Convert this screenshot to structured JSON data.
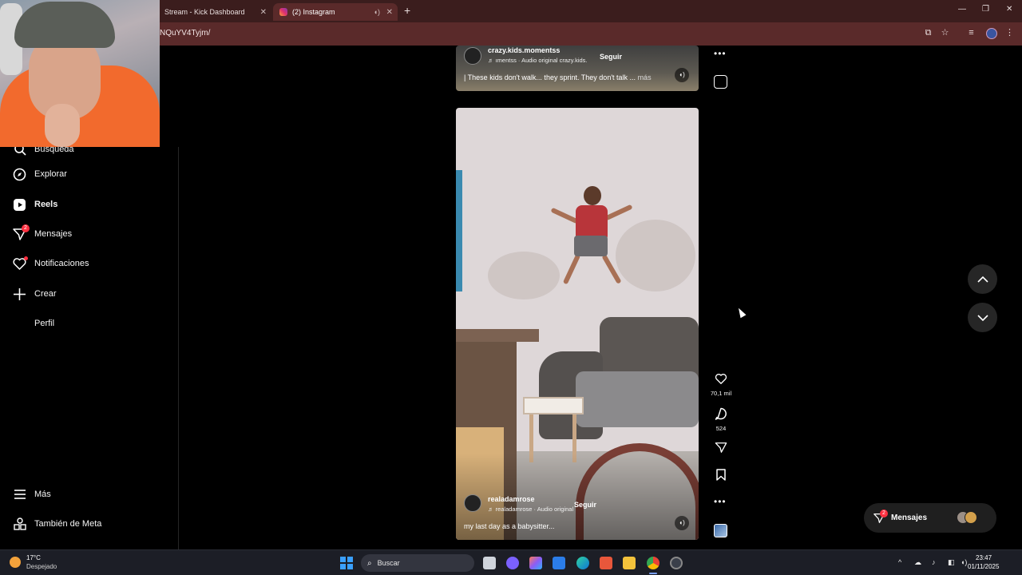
{
  "browser": {
    "tabs": [
      {
        "title": "Stream - Kick Dashboard"
      },
      {
        "title": "(2) Instagram"
      }
    ],
    "url": "NQuYV4Tyjm/"
  },
  "sidebar": {
    "items": [
      {
        "label": "Búsqueda",
        "icon": "search-icon"
      },
      {
        "label": "Explorar",
        "icon": "compass-icon"
      },
      {
        "label": "Reels",
        "icon": "reels-icon",
        "active": true
      },
      {
        "label": "Mensajes",
        "icon": "messenger-icon",
        "badge": "2"
      },
      {
        "label": "Notificaciones",
        "icon": "heart-icon"
      },
      {
        "label": "Crear",
        "icon": "plus-icon"
      },
      {
        "label": "Perfil",
        "icon": "profile-icon"
      }
    ],
    "bottom": [
      {
        "label": "Más",
        "icon": "menu-icon"
      },
      {
        "label": "También de Meta",
        "icon": "meta-apps-icon"
      }
    ]
  },
  "reels": {
    "top": {
      "username": "crazy.kids.momentss",
      "audio": "♬ ımentss · Audio original  crazy.kids.",
      "follow": "Seguir",
      "caption": "| These kids don't walk... they sprint. They don't talk ...",
      "more": "más"
    },
    "main": {
      "username": "realadamrose",
      "audio": "♬ realadamrose · Audio original",
      "follow": "Seguir",
      "caption": "my last day as a babysitter..."
    }
  },
  "actions": {
    "likes": "70,1 mil",
    "comments": "524"
  },
  "messages_pill": {
    "label": "Mensajes",
    "badge": "2"
  },
  "taskbar": {
    "temperature": "17°C",
    "weather": "Despejado",
    "search_placeholder": "Buscar",
    "time": "23:47",
    "date": "01/11/2025"
  },
  "colors": {
    "accent_red": "#ff3040",
    "browser_frame": "#5a2a2a",
    "taskbar": "#1c1e26"
  }
}
